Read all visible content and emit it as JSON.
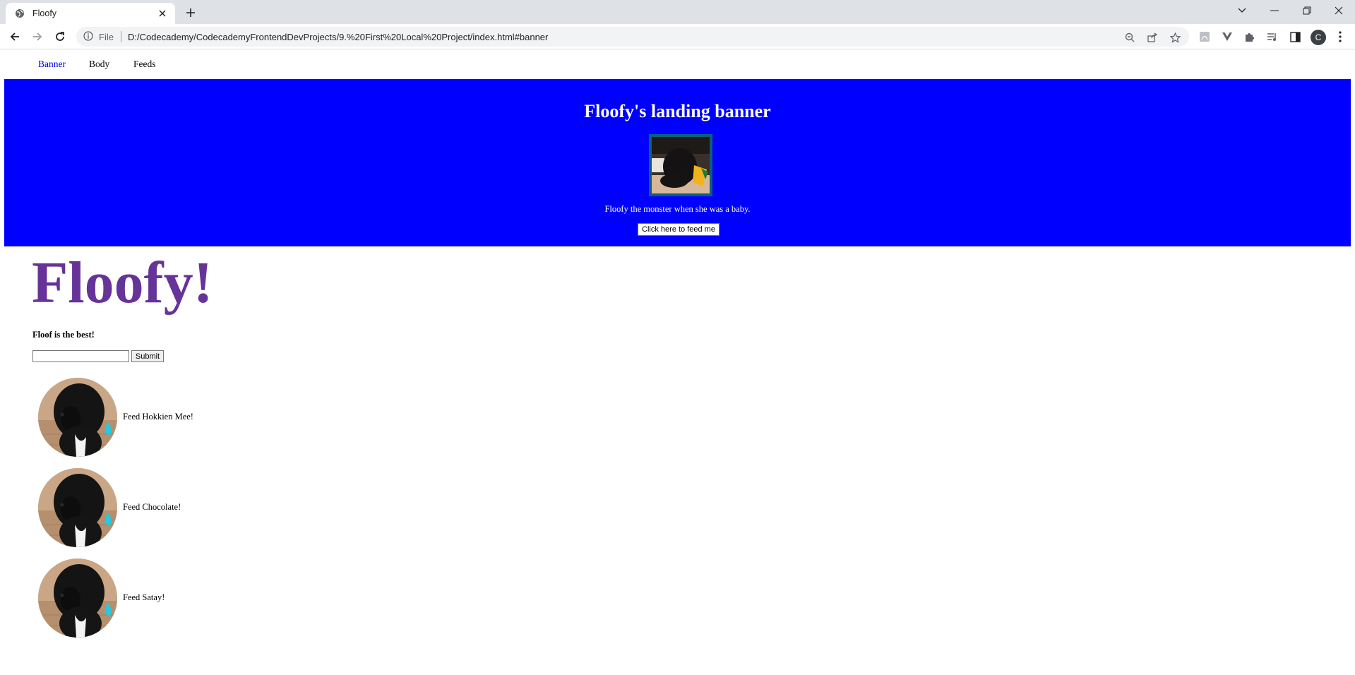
{
  "browser": {
    "tab_title": "Floofy",
    "omnibox": {
      "scheme_label": "File",
      "url": "D:/Codecademy/CodecademyFrontendDevProjects/9.%20First%20Local%20Project/index.html#banner"
    },
    "profile_initial": "C",
    "icons": [
      "globe-icon",
      "close-icon",
      "plus-icon",
      "chevron-down-icon",
      "minimize-icon",
      "restore-icon",
      "window-close-icon",
      "back-icon",
      "forward-icon",
      "reload-icon",
      "info-icon",
      "zoom-icon",
      "share-icon",
      "star-icon",
      "pdf-extension-icon",
      "vue-extension-icon",
      "puzzle-icon",
      "media-icon",
      "side-panel-icon",
      "kebab-menu-icon"
    ]
  },
  "page": {
    "nav": {
      "items": [
        {
          "label": "Banner",
          "active": true
        },
        {
          "label": "Body",
          "active": false
        },
        {
          "label": "Feeds",
          "active": false
        }
      ]
    },
    "banner": {
      "heading": "Floofy's landing banner",
      "caption": "Floofy the monster when she was a baby.",
      "button_label": "Click here to feed me",
      "background": "#0000ff"
    },
    "title": "Floofy!",
    "title_color": "#663399",
    "tagline": "Floof is the best!",
    "form": {
      "input_value": "",
      "submit_label": "Submit"
    },
    "feeds": [
      {
        "label": "Feed Hokkien Mee!"
      },
      {
        "label": "Feed Chocolate!"
      },
      {
        "label": "Feed Satay!"
      }
    ]
  }
}
